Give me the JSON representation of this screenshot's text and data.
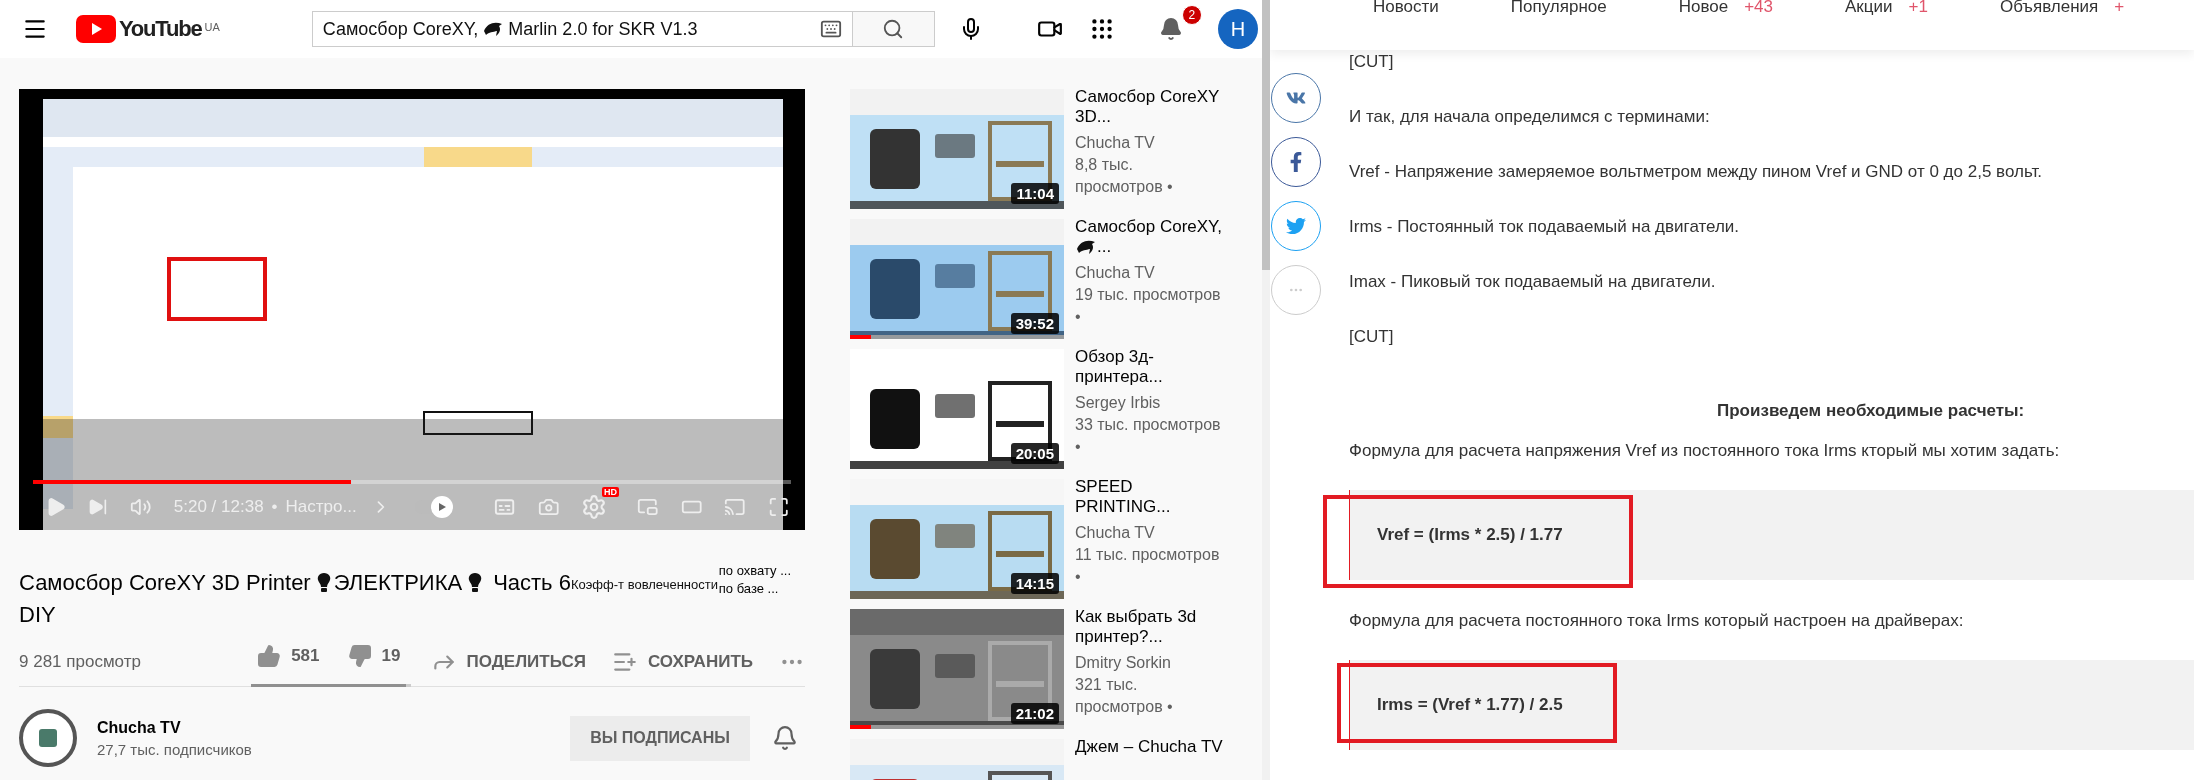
{
  "youtube": {
    "header": {
      "logo": "YouTube",
      "region": "UA",
      "search": {
        "value_parts": [
          "Самосбор CoreXY,",
          "Marlin 2.0 for SKR V1.3"
        ]
      },
      "notification_count": "2",
      "avatar_letter": "H"
    },
    "player": {
      "progress": {
        "level": 0.42
      },
      "time": "5:20 / 12:38",
      "separator": "•",
      "chapter": "Настро...",
      "autoplay": {
        "on": true
      },
      "quality": "HD"
    },
    "video": {
      "title_parts": [
        "Самосбор CoreXY 3D Printer",
        "ЭЛЕКТРИКА",
        "Часть 6"
      ],
      "title_continued": "DIY",
      "views": "9 281 просмотр",
      "likes": "581",
      "dislikes": "19",
      "rating": {
        "level": 0.97
      },
      "share": "ПОДЕЛИТЬСЯ",
      "save": "СОХРАНИТЬ"
    },
    "extension_overlay": {
      "label": "Коэфф-т вовлеченности",
      "lines": [
        "по охвату ...",
        "по базе ..."
      ]
    },
    "channel": {
      "name": "Chucha TV",
      "subscribers": "27,7 тыс. подписчиков",
      "subscribe_button": "ВЫ ПОДПИСАНЫ"
    },
    "recommendations": [
      {
        "title_parts": [
          "Самосбор CoreXY 3D..."
        ],
        "channel": "Chucha TV",
        "views": "8,8 тыс. просмотров •",
        "duration": "11:04"
      },
      {
        "title_parts": [
          "Самосбор CoreXY,",
          "..."
        ],
        "channel": "Chucha TV",
        "views": "19 тыс. просмотров •",
        "duration": "39:52",
        "watched": {
          "level": 0.1
        }
      },
      {
        "title_parts": [
          "Обзор 3д-принтера..."
        ],
        "channel": "Sergey Irbis",
        "views": "33 тыс. просмотров •",
        "duration": "20:05"
      },
      {
        "title_parts": [
          "SPEED PRINTING..."
        ],
        "channel": "Chucha TV",
        "views": "11 тыс. просмотров •",
        "duration": "14:15"
      },
      {
        "title_parts": [
          "Как выбрать 3d принтер?..."
        ],
        "channel": "Dmitry Sorkin",
        "views": "321 тыс. просмотров •",
        "duration": "21:02",
        "watched": {
          "level": 0.1
        }
      },
      {
        "title_parts": [
          "Джем – Chucha TV"
        ]
      }
    ]
  },
  "article": {
    "nav": [
      {
        "label": "Новости"
      },
      {
        "label": "Популярное"
      },
      {
        "label": "Новое",
        "count": "+43"
      },
      {
        "label": "Акции",
        "count": "+1"
      },
      {
        "label": "Объявления",
        "count": "+"
      }
    ],
    "share_buttons": [
      {
        "kind": "vk"
      },
      {
        "kind": "facebook"
      },
      {
        "kind": "twitter"
      },
      {
        "kind": "more"
      }
    ],
    "blocks": [
      {
        "kind": "paragraph",
        "text": "[CUT]"
      },
      {
        "kind": "paragraph",
        "text": "И так, для начала определимся с терминами:"
      },
      {
        "kind": "paragraph",
        "text": "Vref - Напряжение замеряемое вольтметром между пином Vref и GND от 0 до 2,5 вольт."
      },
      {
        "kind": "paragraph",
        "text": "Irms - Постоянный ток подаваемый на двигатели."
      },
      {
        "kind": "paragraph",
        "text": "Imax - Пиковый ток подаваемый на двигатели."
      },
      {
        "kind": "paragraph",
        "text": "[CUT]"
      },
      {
        "kind": "heading",
        "text": "Произведем необходимые расчеты:"
      },
      {
        "kind": "paragraph",
        "text": "Формула для расчета напряжения Vref из постоянного тока Irms кторый мы хотим задать:"
      },
      {
        "kind": "formula",
        "text": "Vref = (Irms * 2.5) / 1.77"
      },
      {
        "kind": "paragraph",
        "text": "Формула для расчета постоянного тока Irms который настроен на драйверах:"
      },
      {
        "kind": "formula",
        "text": "Irms = (Vref * 1.77) / 2.5"
      }
    ]
  }
}
